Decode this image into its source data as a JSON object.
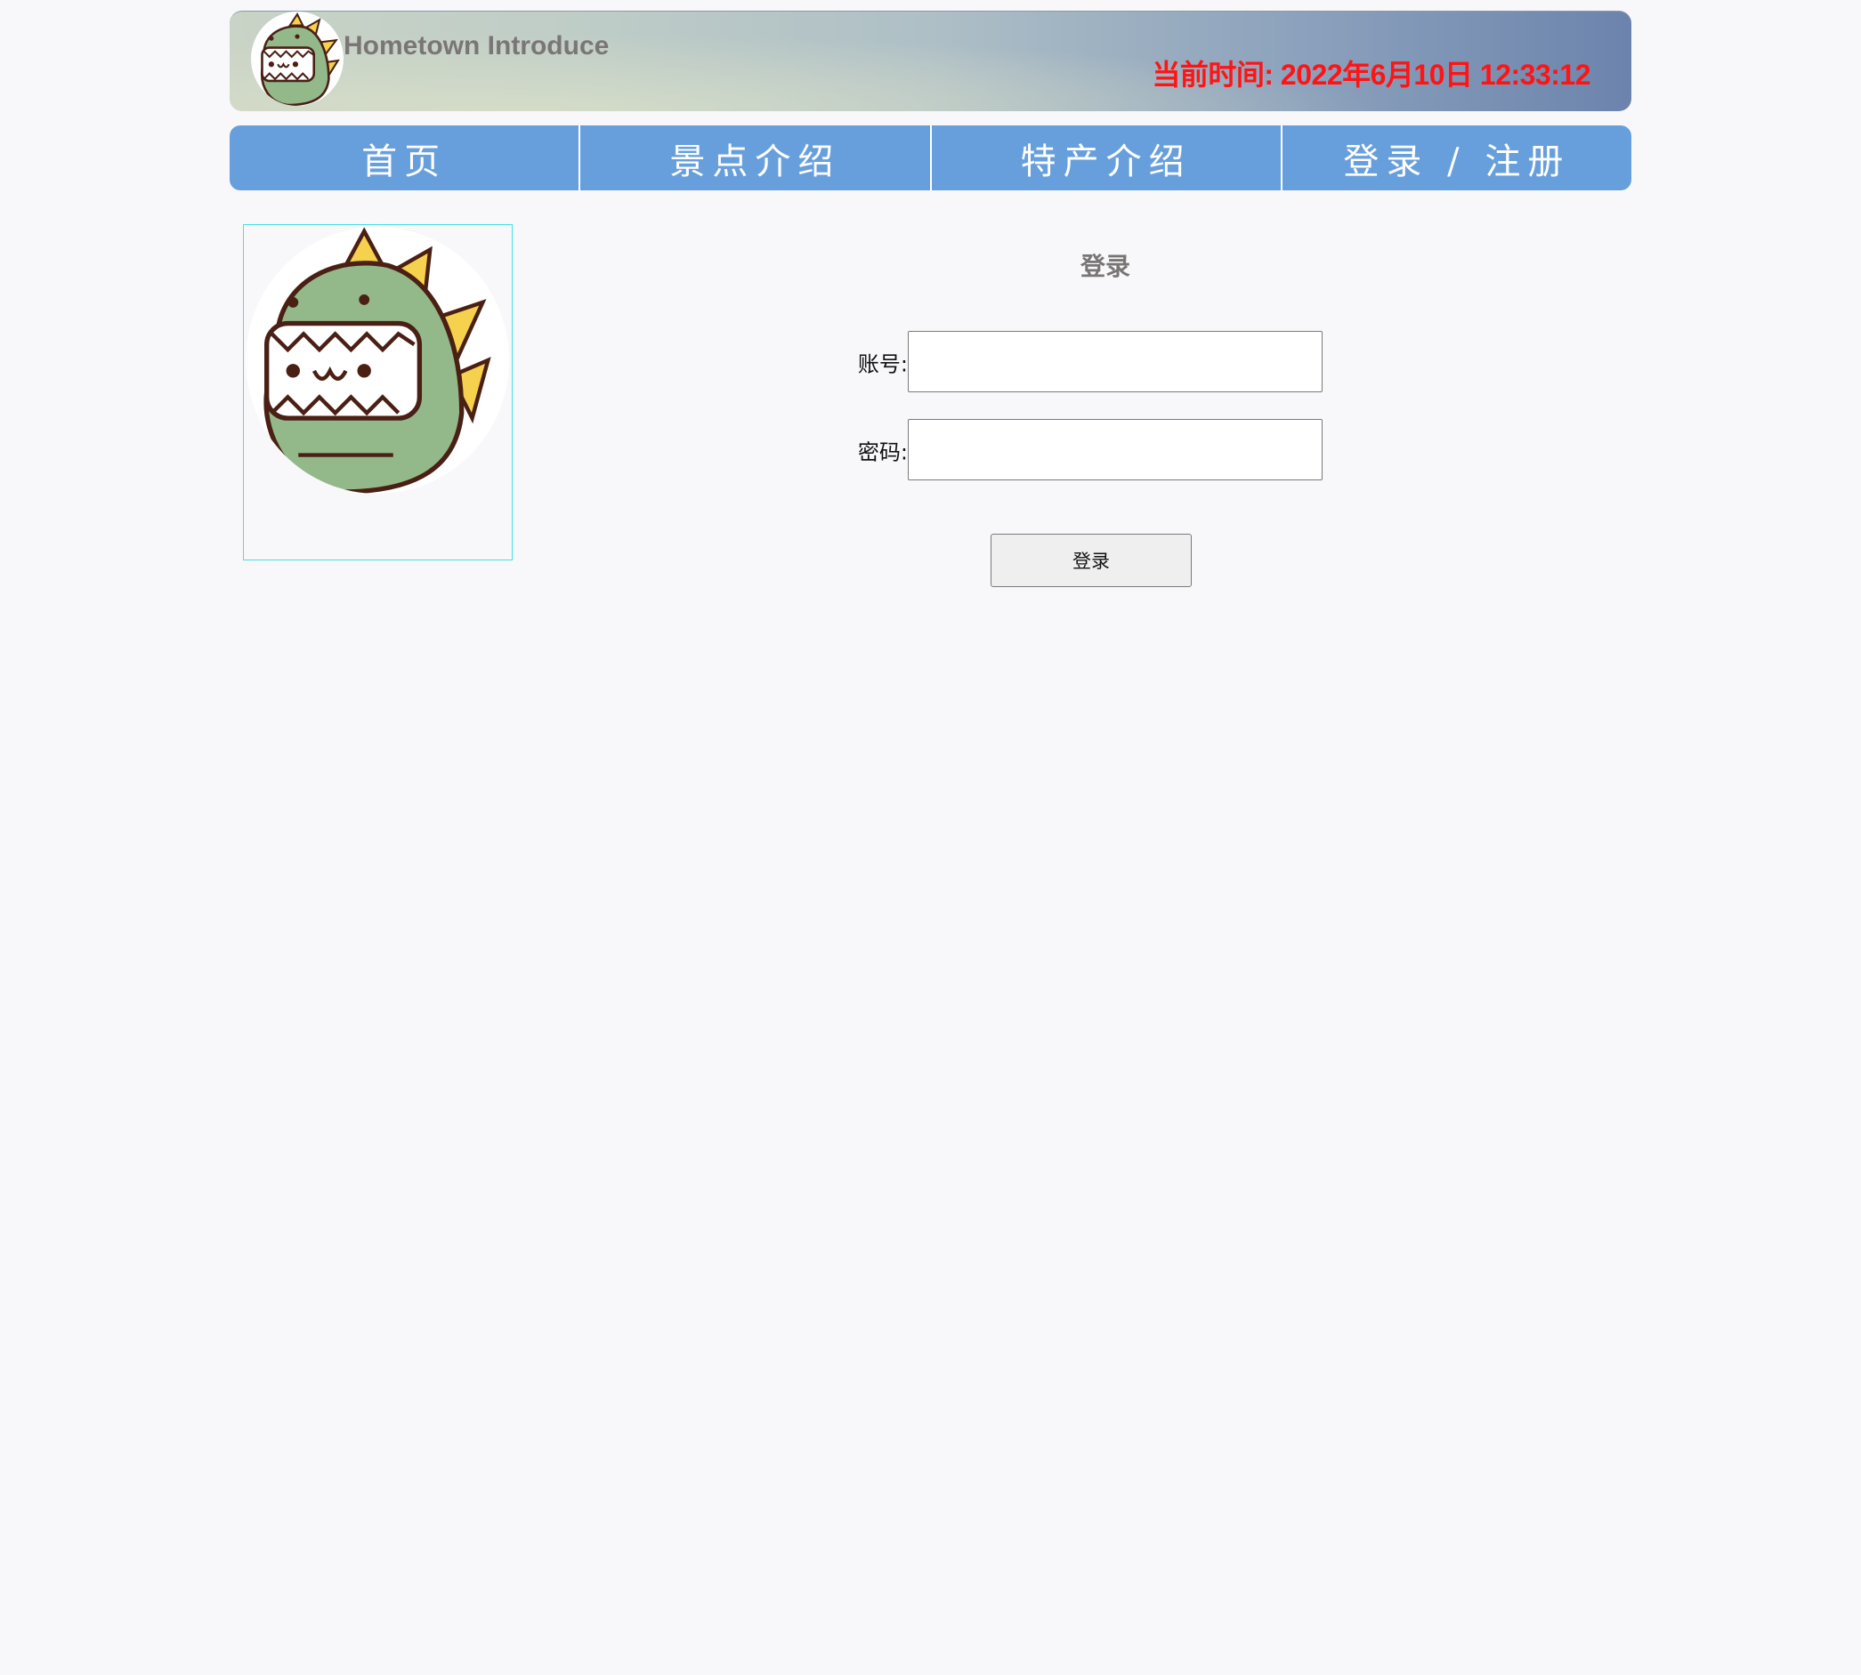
{
  "header": {
    "title": "Hometown Introduce",
    "time_label": "当前时间: 2022年6月10日 12:33:12",
    "time_color": "#ff1414",
    "logo_icon": "dinosaur-avatar-icon"
  },
  "nav": {
    "items": [
      {
        "label": "首页"
      },
      {
        "label": "景点介绍"
      },
      {
        "label": "特产介绍"
      },
      {
        "label": "登录 / 注册"
      }
    ],
    "color": "#679fdc"
  },
  "avatar": {
    "icon": "dinosaur-avatar-icon",
    "border_color": "#46e0e6"
  },
  "login": {
    "title": "登录",
    "account_label": "账号:",
    "account_value": "",
    "account_placeholder": "",
    "password_label": "密码:",
    "password_value": "",
    "password_placeholder": "",
    "submit_label": "登录"
  }
}
